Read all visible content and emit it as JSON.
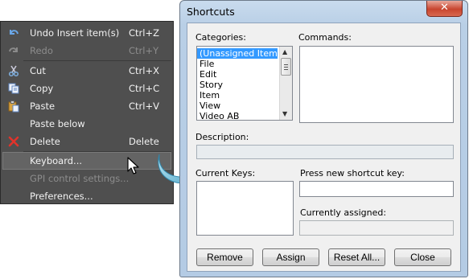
{
  "context_menu": {
    "items": [
      {
        "label": "Undo Insert item(s)",
        "shortcut": "Ctrl+Z",
        "icon": "undo-icon"
      },
      {
        "label": "Redo",
        "shortcut": "Ctrl+Y",
        "icon": "redo-icon",
        "disabled": true
      },
      {
        "label": "Cut",
        "shortcut": "Ctrl+X",
        "icon": "scissors-icon"
      },
      {
        "label": "Copy",
        "shortcut": "Ctrl+C",
        "icon": "copy-icon"
      },
      {
        "label": "Paste",
        "shortcut": "Ctrl+V",
        "icon": "paste-icon"
      },
      {
        "label": "Paste below",
        "shortcut": ""
      },
      {
        "label": "Delete",
        "shortcut": "Delete",
        "icon": "delete-x-icon"
      },
      {
        "label": "Keyboard...",
        "shortcut": "",
        "highlighted": true
      },
      {
        "label": "GPI control settings...",
        "shortcut": "",
        "disabled": true
      },
      {
        "label": "Preferences...",
        "shortcut": ""
      }
    ]
  },
  "dialog": {
    "title": "Shortcuts",
    "close_glyph": "✕",
    "categories_label": "Categories:",
    "commands_label": "Commands:",
    "categories": [
      "(Unassigned Items)",
      "File",
      "Edit",
      "Story",
      "Item",
      "View",
      "Video AB"
    ],
    "selected_category": "(Unassigned Items)",
    "description_label": "Description:",
    "current_keys_label": "Current Keys:",
    "new_shortcut_label": "Press new shortcut key:",
    "currently_assigned_label": "Currently assigned:",
    "buttons": {
      "remove": "Remove",
      "assign": "Assign",
      "reset_all": "Reset All...",
      "close": "Close"
    }
  },
  "colors": {
    "menu_bg": "#4f4f4f",
    "selection": "#3399ff",
    "window_frame": "#b9cfe6",
    "arrow": "#5fb8d4"
  }
}
